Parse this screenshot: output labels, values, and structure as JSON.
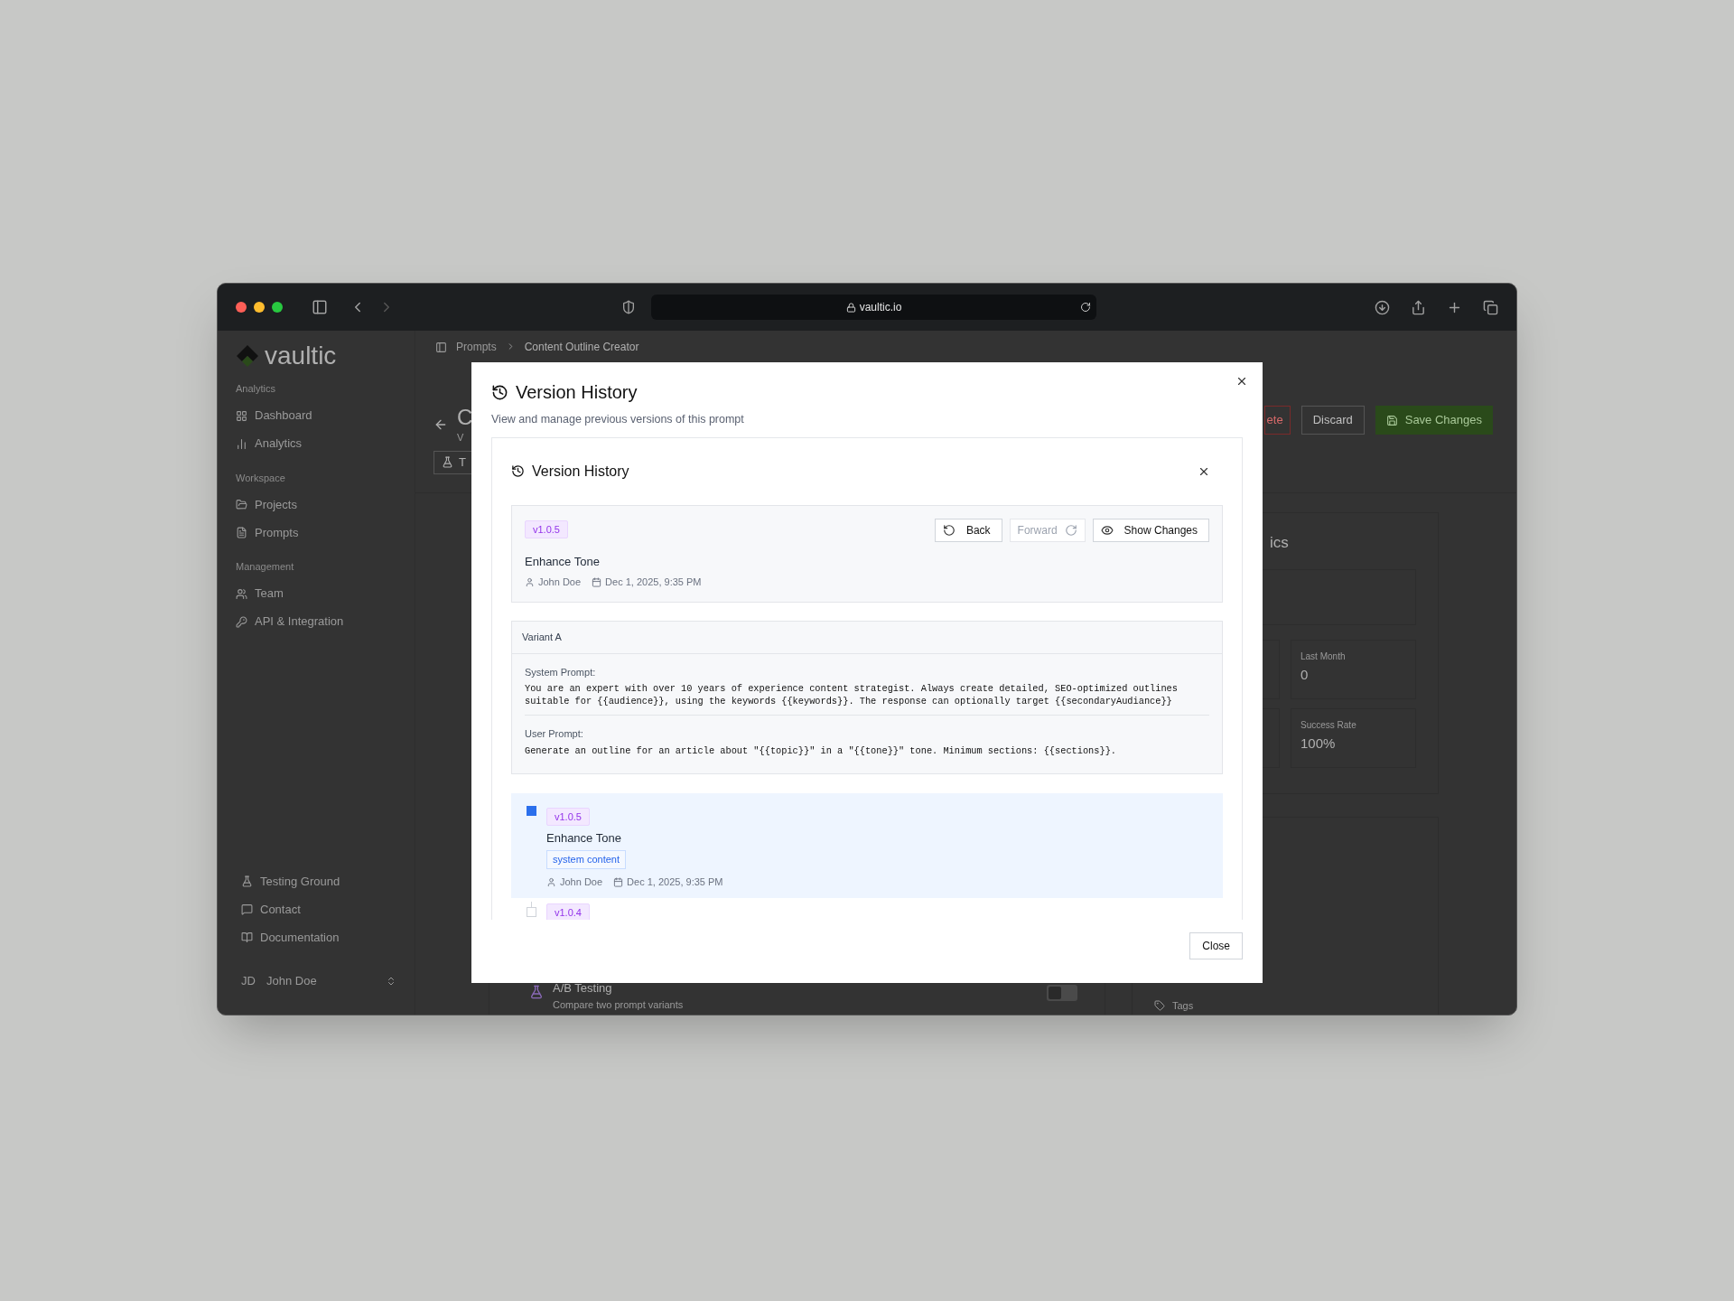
{
  "browser": {
    "url": "vaultic.io"
  },
  "sidebar": {
    "logo": "vaultic",
    "sections": [
      {
        "heading": "Analytics",
        "items": [
          {
            "label": "Dashboard"
          },
          {
            "label": "Analytics"
          }
        ]
      },
      {
        "heading": "Workspace",
        "items": [
          {
            "label": "Projects"
          },
          {
            "label": "Prompts"
          }
        ]
      },
      {
        "heading": "Management",
        "items": [
          {
            "label": "Team"
          },
          {
            "label": "API & Integration"
          }
        ]
      }
    ],
    "footer_items": [
      {
        "label": "Testing Ground"
      },
      {
        "label": "Contact"
      },
      {
        "label": "Documentation"
      }
    ],
    "user": {
      "initials": "JD",
      "name": "John Doe"
    }
  },
  "background": {
    "breadcrumb": [
      "Prompts",
      "Content Outline Creator"
    ],
    "title_fragment": "C",
    "subtitle_fragment": "V",
    "tab_fragment": "T",
    "buttons": [
      {
        "label": "ete",
        "kind": "danger"
      },
      {
        "label": "Discard",
        "kind": "outline"
      },
      {
        "label": "Save Changes",
        "kind": "primary"
      }
    ],
    "stats_title_fragment": "ics",
    "stats": [
      {
        "label": "Last Month",
        "value": "0"
      },
      {
        "label": "Success Rate",
        "value": "100%"
      }
    ],
    "feature": {
      "title": "A/B Testing",
      "description": "Compare two prompt variants",
      "on": false
    },
    "tags_label": "Tags"
  },
  "dialog": {
    "title": "Version History",
    "subtitle": "View and manage previous versions of this prompt",
    "panel": {
      "title": "Version History",
      "current": {
        "version": "v1.0.5",
        "title": "Enhance Tone",
        "author": "John Doe",
        "date": "Dec 1, 2025, 9:35 PM",
        "actions": [
          {
            "label": "Back",
            "kind": "back",
            "disabled": false
          },
          {
            "label": "Forward",
            "kind": "forward",
            "disabled": true
          },
          {
            "label": "Show Changes",
            "kind": "changes",
            "disabled": false
          }
        ]
      },
      "variant": {
        "name": "Variant A",
        "sections": [
          {
            "label": "System Prompt:",
            "text": "You are an expert with over 10 years of experience content strategist. Always create detailed, SEO-optimized outlines suitable for {{audience}}, using the keywords {{keywords}}. The response can optionally target {{secondaryAudiance}}"
          },
          {
            "label": "User Prompt:",
            "text": "Generate an outline for an article about \"{{topic}}\" in a \"{{tone}}\" tone. Minimum sections: {{sections}}."
          }
        ]
      },
      "timeline": [
        {
          "version": "v1.0.5",
          "selected": true,
          "title": "Enhance Tone",
          "tag": "system content",
          "author": "John Doe",
          "date": "Dec 1, 2025, 9:35 PM"
        },
        {
          "version": "v1.0.4",
          "selected": false
        }
      ]
    },
    "close_button": "Close"
  }
}
